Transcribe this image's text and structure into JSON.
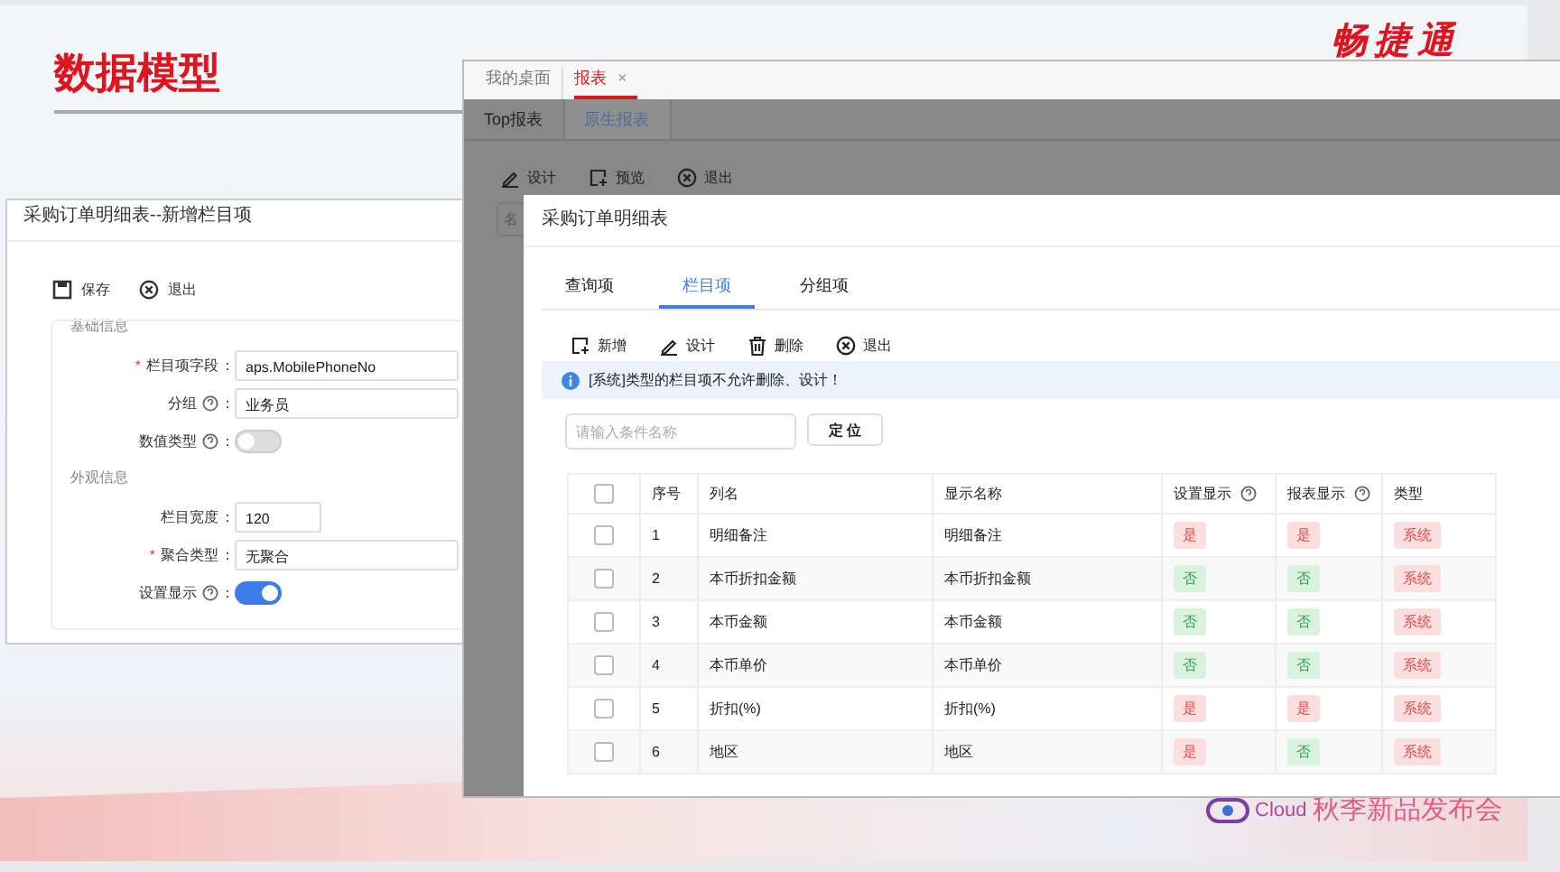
{
  "slide": {
    "title": "数据模型",
    "brand": "畅捷通",
    "footer_brand": "Cloud",
    "footer_event": "秋季新品发布会"
  },
  "left_dialog": {
    "title": "采购订单明细表--新增栏目项",
    "toolbar": [
      {
        "kind": "save",
        "label": "保存"
      },
      {
        "kind": "exit",
        "label": "退出"
      }
    ],
    "sections": [
      {
        "title": "基础信息",
        "fields": [
          {
            "kind": "input",
            "mark": "*",
            "label": "栏目项字段",
            "help": false,
            "colon": "：",
            "value": "aps.MobilePhoneNo",
            "wide": true
          },
          {
            "kind": "input",
            "label": "分组",
            "help": true,
            "colon": "：",
            "value": "业务员",
            "wide": true
          },
          {
            "kind": "switch",
            "label": "数值类型",
            "help": true,
            "colon": "：",
            "on": false
          }
        ]
      },
      {
        "title": "外观信息",
        "fields": [
          {
            "kind": "input",
            "label": "栏目宽度",
            "help": false,
            "colon": "：",
            "value": "120",
            "wide": false
          },
          {
            "kind": "input",
            "mark": "*",
            "label": "聚合类型",
            "help": false,
            "colon": "：",
            "value": "无聚合",
            "wide": true
          },
          {
            "kind": "switch",
            "label": "设置显示",
            "help": true,
            "colon": "：",
            "on": true
          }
        ]
      }
    ]
  },
  "back_window": {
    "tabs": [
      {
        "label": "我的桌面",
        "selected": false
      },
      {
        "label": "报表",
        "selected": true,
        "close": "×"
      }
    ],
    "subtabs": [
      {
        "label": "Top报表",
        "selected": false
      },
      {
        "label": "原生报表",
        "selected": true
      }
    ],
    "toolbar": [
      {
        "kind": "edit",
        "label": "设计"
      },
      {
        "kind": "preview",
        "label": "预览"
      },
      {
        "kind": "exit",
        "label": "退出"
      }
    ],
    "search_placeholder": "名"
  },
  "dialog": {
    "title": "采购订单明细表",
    "tabs": [
      {
        "label": "查询项",
        "selected": false
      },
      {
        "label": "栏目项",
        "selected": true
      },
      {
        "label": "分组项",
        "selected": false
      }
    ],
    "toolbar": [
      {
        "kind": "add",
        "label": "新增"
      },
      {
        "kind": "edit",
        "label": "设计"
      },
      {
        "kind": "delete",
        "label": "删除"
      },
      {
        "kind": "exit",
        "label": "退出"
      }
    ],
    "notice": "[系统]类型的栏目项不允许删除、设计！",
    "search_placeholder": "请输入条件名称",
    "locate_button": "定 位",
    "table": {
      "header_checked": false,
      "columns": [
        {
          "label": "序号",
          "help": false
        },
        {
          "label": "列名",
          "help": false
        },
        {
          "label": "显示名称",
          "help": false
        },
        {
          "label": "设置显示",
          "help": true
        },
        {
          "label": "报表显示",
          "help": true
        },
        {
          "label": "类型",
          "help": false
        }
      ],
      "rows": [
        {
          "checked": false,
          "index": "1",
          "name": "明细备注",
          "display": "明细备注",
          "setting": {
            "text": "是",
            "on": true
          },
          "report": {
            "text": "是",
            "on": true
          },
          "type": {
            "text": "系统",
            "kind": "system"
          }
        },
        {
          "checked": false,
          "index": "2",
          "name": "本币折扣金额",
          "display": "本币折扣金额",
          "setting": {
            "text": "否",
            "on": false
          },
          "report": {
            "text": "否",
            "on": false
          },
          "type": {
            "text": "系统",
            "kind": "system"
          }
        },
        {
          "checked": false,
          "index": "3",
          "name": "本币金额",
          "display": "本币金额",
          "setting": {
            "text": "否",
            "on": false
          },
          "report": {
            "text": "否",
            "on": false
          },
          "type": {
            "text": "系统",
            "kind": "system"
          }
        },
        {
          "checked": false,
          "index": "4",
          "name": "本币单价",
          "display": "本币单价",
          "setting": {
            "text": "否",
            "on": false
          },
          "report": {
            "text": "否",
            "on": false
          },
          "type": {
            "text": "系统",
            "kind": "system"
          }
        },
        {
          "checked": false,
          "index": "5",
          "name": "折扣(%)",
          "display": "折扣(%)",
          "setting": {
            "text": "是",
            "on": true
          },
          "report": {
            "text": "是",
            "on": true
          },
          "type": {
            "text": "系统",
            "kind": "system"
          }
        },
        {
          "checked": false,
          "index": "6",
          "name": "地区",
          "display": "地区",
          "setting": {
            "text": "是",
            "on": true
          },
          "report": {
            "text": "否",
            "on": false
          },
          "type": {
            "text": "系统",
            "kind": "system"
          }
        }
      ]
    }
  }
}
